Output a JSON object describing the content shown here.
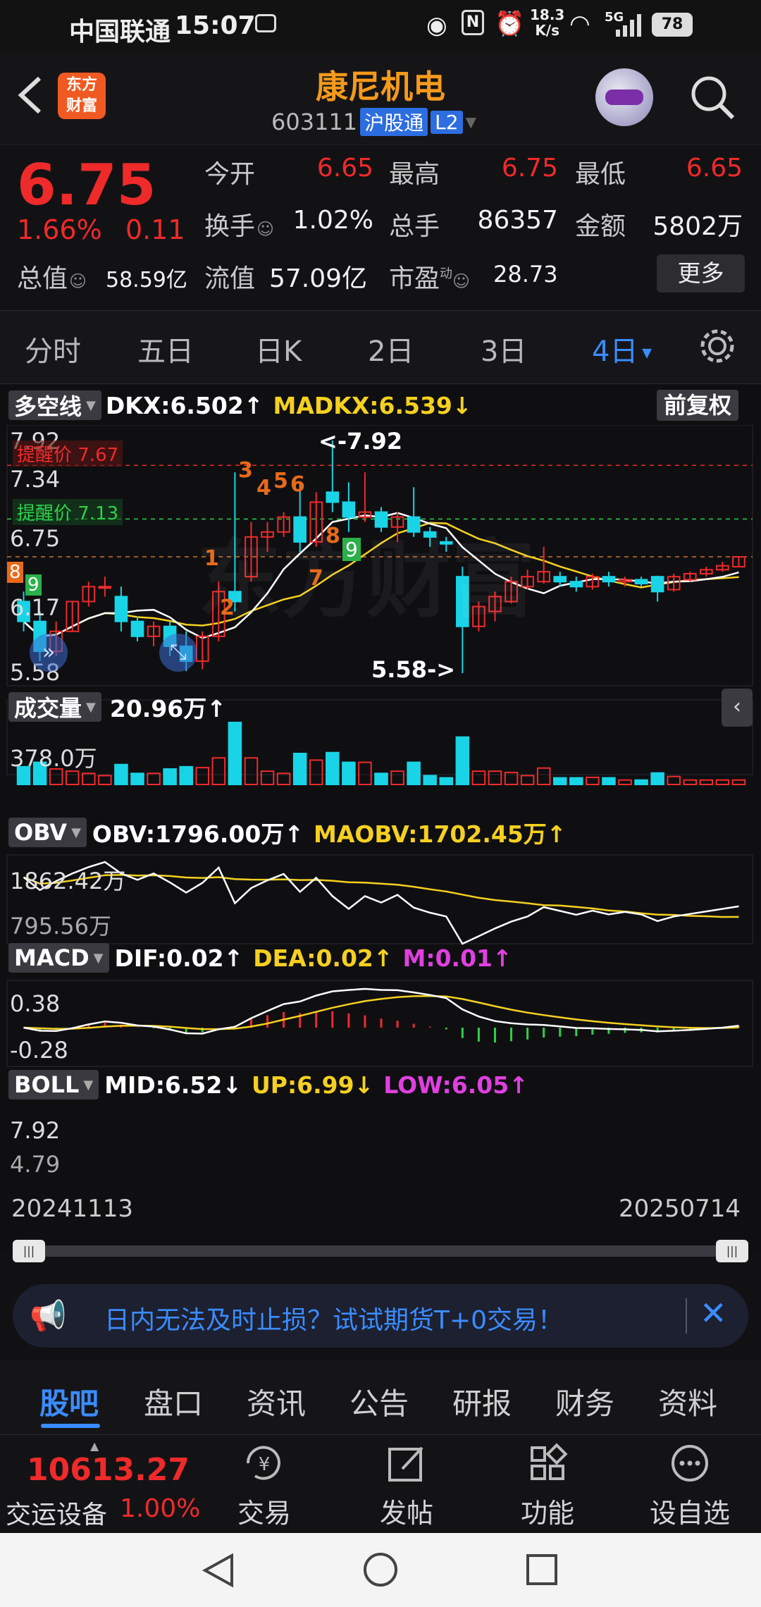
{
  "status_bar": {
    "carrier": "中国联通",
    "time": "15:07",
    "net_speed_top": "18.3",
    "net_speed_bottom": "K/s",
    "signal": "5G",
    "battery": "78"
  },
  "header": {
    "title": "康尼机电",
    "code": "603111",
    "tag": "沪股通",
    "level": "L2",
    "logo_line1": "东方",
    "logo_line2": "财富"
  },
  "quote": {
    "price": "6.75",
    "change_pct": "1.66%",
    "change_abs": "0.11",
    "open_label": "今开",
    "open": "6.65",
    "high_label": "最高",
    "high": "6.75",
    "low_label": "最低",
    "low": "6.65",
    "turnover_label": "换手",
    "turnover": "1.02%",
    "volume_label": "总手",
    "volume": "86357",
    "amount_label": "金额",
    "amount": "5802万",
    "mktcap_label": "总值",
    "mktcap": "58.59亿",
    "float_label": "流值",
    "float": "57.09亿",
    "pe_label": "市盈",
    "pe_sup": "动",
    "pe": "28.73",
    "more_label": "更多"
  },
  "period_tabs": [
    "分时",
    "五日",
    "日K",
    "2日",
    "3日",
    "4日"
  ],
  "active_tab_index": 5,
  "main_chart": {
    "indicator_label": "多空线",
    "dkx": "DKX:6.502↑",
    "madkx": "MADKX:6.539↓",
    "adjust_label": "前复权",
    "axis": [
      "7.92",
      "7.34",
      "6.75",
      "6.17",
      "5.58"
    ],
    "alert_red": "提醒价 7.67",
    "alert_green": "提醒价 7.13",
    "max_label": "<-7.92",
    "min_label": "5.58->",
    "watermark": "东方财富"
  },
  "chart_data": [
    {
      "type": "candlestick",
      "title": "多空线",
      "ylim": [
        5.58,
        7.92
      ],
      "candles": [
        {
          "o": 6.3,
          "h": 6.4,
          "l": 6.0,
          "c": 6.1
        },
        {
          "o": 6.1,
          "h": 6.2,
          "l": 5.7,
          "c": 5.8
        },
        {
          "o": 5.8,
          "h": 6.1,
          "l": 5.75,
          "c": 6.0
        },
        {
          "o": 6.0,
          "h": 6.3,
          "l": 6.0,
          "c": 6.3
        },
        {
          "o": 6.3,
          "h": 6.5,
          "l": 6.25,
          "c": 6.45
        },
        {
          "o": 6.45,
          "h": 6.55,
          "l": 6.35,
          "c": 6.45
        },
        {
          "o": 6.35,
          "h": 6.45,
          "l": 6.0,
          "c": 6.1
        },
        {
          "o": 6.1,
          "h": 6.15,
          "l": 5.9,
          "c": 5.95
        },
        {
          "o": 5.95,
          "h": 6.1,
          "l": 5.85,
          "c": 6.05
        },
        {
          "o": 6.05,
          "h": 6.1,
          "l": 5.75,
          "c": 5.85
        },
        {
          "o": 5.85,
          "h": 6.0,
          "l": 5.6,
          "c": 5.7
        },
        {
          "o": 5.7,
          "h": 6.0,
          "l": 5.62,
          "c": 5.95
        },
        {
          "o": 5.95,
          "h": 6.5,
          "l": 5.9,
          "c": 6.4
        },
        {
          "o": 6.4,
          "h": 7.6,
          "l": 6.2,
          "c": 6.3
        },
        {
          "o": 6.55,
          "h": 7.1,
          "l": 6.5,
          "c": 6.95
        },
        {
          "o": 6.95,
          "h": 7.1,
          "l": 6.8,
          "c": 7.0
        },
        {
          "o": 7.0,
          "h": 7.2,
          "l": 6.95,
          "c": 7.15
        },
        {
          "o": 7.15,
          "h": 7.5,
          "l": 6.8,
          "c": 6.9
        },
        {
          "o": 6.9,
          "h": 7.4,
          "l": 6.85,
          "c": 7.3
        },
        {
          "o": 7.4,
          "h": 7.92,
          "l": 7.2,
          "c": 7.3
        },
        {
          "o": 7.3,
          "h": 7.5,
          "l": 7.0,
          "c": 7.15
        },
        {
          "o": 7.15,
          "h": 7.6,
          "l": 7.1,
          "c": 7.2
        },
        {
          "o": 7.2,
          "h": 7.25,
          "l": 7.0,
          "c": 7.05
        },
        {
          "o": 7.05,
          "h": 7.2,
          "l": 6.9,
          "c": 7.15
        },
        {
          "o": 7.15,
          "h": 7.45,
          "l": 6.95,
          "c": 7.0
        },
        {
          "o": 7.0,
          "h": 7.05,
          "l": 6.85,
          "c": 6.95
        },
        {
          "o": 6.9,
          "h": 6.95,
          "l": 6.8,
          "c": 6.88
        },
        {
          "o": 6.55,
          "h": 6.65,
          "l": 5.58,
          "c": 6.05
        },
        {
          "o": 6.05,
          "h": 6.3,
          "l": 6.0,
          "c": 6.25
        },
        {
          "o": 6.2,
          "h": 6.4,
          "l": 6.1,
          "c": 6.35
        },
        {
          "o": 6.3,
          "h": 6.55,
          "l": 6.28,
          "c": 6.5
        },
        {
          "o": 6.45,
          "h": 6.62,
          "l": 6.42,
          "c": 6.55
        },
        {
          "o": 6.5,
          "h": 6.85,
          "l": 6.48,
          "c": 6.6
        },
        {
          "o": 6.55,
          "h": 6.6,
          "l": 6.45,
          "c": 6.5
        },
        {
          "o": 6.5,
          "h": 6.55,
          "l": 6.4,
          "c": 6.45
        },
        {
          "o": 6.45,
          "h": 6.58,
          "l": 6.42,
          "c": 6.55
        },
        {
          "o": 6.55,
          "h": 6.6,
          "l": 6.45,
          "c": 6.5
        },
        {
          "o": 6.5,
          "h": 6.55,
          "l": 6.45,
          "c": 6.52
        },
        {
          "o": 6.52,
          "h": 6.55,
          "l": 6.45,
          "c": 6.48
        },
        {
          "o": 6.55,
          "h": 6.56,
          "l": 6.3,
          "c": 6.4
        },
        {
          "o": 6.42,
          "h": 6.58,
          "l": 6.4,
          "c": 6.55
        },
        {
          "o": 6.52,
          "h": 6.6,
          "l": 6.5,
          "c": 6.58
        },
        {
          "o": 6.58,
          "h": 6.65,
          "l": 6.55,
          "c": 6.62
        },
        {
          "o": 6.62,
          "h": 6.7,
          "l": 6.6,
          "c": 6.66
        },
        {
          "o": 6.65,
          "h": 6.75,
          "l": 6.65,
          "c": 6.75
        }
      ]
    },
    {
      "type": "bar",
      "title": "成交量",
      "ylim": [
        0,
        378.0
      ]
    },
    {
      "type": "line",
      "title": "OBV",
      "ylim": [
        795.56,
        1862.42
      ]
    },
    {
      "type": "line",
      "title": "MACD",
      "ylim": [
        -0.28,
        0.38
      ]
    },
    {
      "type": "line",
      "title": "BOLL",
      "ylim": [
        4.79,
        7.92
      ]
    }
  ],
  "volume": {
    "label": "成交量",
    "value": "20.96万↑",
    "axis_top": "378.0万"
  },
  "obv": {
    "label": "OBV",
    "obv": "OBV:1796.00万↑",
    "maobv": "MAOBV:1702.45万↑",
    "axis_top": "1862.42万",
    "axis_bottom": "795.56万"
  },
  "macd": {
    "label": "MACD",
    "dif": "DIF:0.02↑",
    "dea": "DEA:0.02↑",
    "m": "M:0.01↑",
    "axis_top": "0.38",
    "axis_bottom": "-0.28"
  },
  "boll": {
    "label": "BOLL",
    "mid": "MID:6.52↓",
    "up": "UP:6.99↓",
    "low": "LOW:6.05↑",
    "axis_top": "7.92",
    "axis_bottom": "4.79"
  },
  "date_range": {
    "start": "20241113",
    "end": "20250714"
  },
  "banner": {
    "text": "日内无法及时止损？试试期货T+0交易！"
  },
  "news_tabs": [
    "股吧",
    "盘口",
    "资讯",
    "公告",
    "研报",
    "财务",
    "资料"
  ],
  "bottom_nav": {
    "index_value": "10613.27",
    "index_name": "交运设备",
    "index_change": "1.00%",
    "items": [
      "交易",
      "发帖",
      "功能",
      "设自选"
    ]
  },
  "colors": {
    "up": "#ef2a2a",
    "down": "#19d4e6",
    "active_tab": "#3b8cff",
    "dkx": "#ffffff",
    "madkx": "#f5d020",
    "magenta": "#e040e0"
  }
}
